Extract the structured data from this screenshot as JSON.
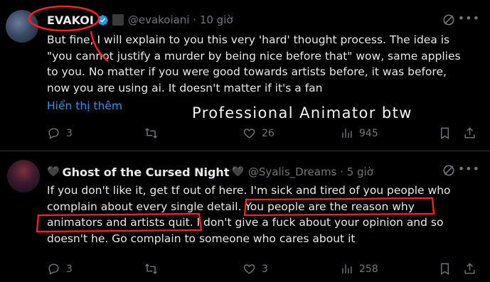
{
  "tweets": [
    {
      "name": "EVAKOI",
      "handle": "@evakoiani",
      "time": "10 giờ",
      "lines": [
        "But fine, I will explain to you this very 'hard' thought process. The idea is",
        "\"you cannot justify a murder by being nice before that\" wow, same applies",
        "to you. No matter if you were good towards artists before, it was before,",
        "now you are using ai. It doesn't matter if it's a fan"
      ],
      "show_more": "Hiển thị thêm",
      "overlay": "Professional Animator btw",
      "replies": "3",
      "reposts": "",
      "likes": "26",
      "views": "945",
      "icons": [
        "avatar",
        "verified-icon",
        "badge-icon",
        "grok-icon",
        "more-icon",
        "reply-icon",
        "repost-icon",
        "like-icon",
        "views-icon",
        "bookmark-icon",
        "share-icon"
      ]
    },
    {
      "name": "Ghost of the Cursed Night",
      "name_prefix": "🖤",
      "name_suffix": "🖤",
      "handle": "@Syalis_Dreams",
      "time": "5 giờ",
      "lines": [
        "If you don't like it, get tf out of here. I'm sick and tired of you people who",
        "complain about every single detail. You people are the reason why",
        "animators and artists quit. I don't give a fuck about your opinion and so",
        "doesn't he. Go complain to someone who cares about it"
      ],
      "replies": "3",
      "reposts": "",
      "likes": "3",
      "views": "258"
    }
  ],
  "colors": {
    "background": "#000000",
    "text": "#e7e9ea",
    "muted": "#71767b",
    "link": "#1d9bf0",
    "verified": "#1d9bf0",
    "annotation": "#ff1f1f"
  }
}
